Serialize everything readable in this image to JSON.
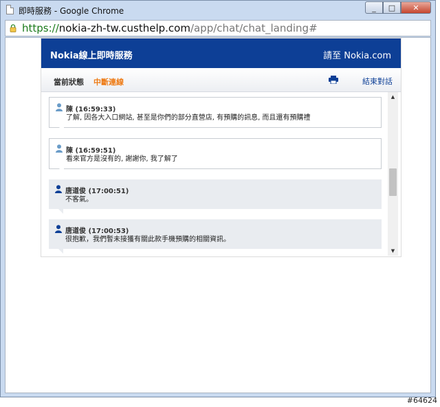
{
  "window": {
    "title": "即時服務 - Google Chrome",
    "buttons": {
      "minimize": "_",
      "maximize": "□",
      "close": "✕"
    }
  },
  "address": {
    "scheme": "https://",
    "host": "nokia-zh-tw.custhelp.com",
    "path": "/app/chat/chat_landing#"
  },
  "chat": {
    "header_title": "Nokia線上即時服務",
    "header_link": "請至 Nokia.com",
    "status_label": "當前狀態",
    "status_value": "中斷連線",
    "end_chat": "結束對話",
    "messages": [
      {
        "type": "user",
        "sender": "陳",
        "time": "(16:59:33)",
        "text": "了解, 因各大入口網站, 甚至是你們的部分直營店, 有預購的訊息, 而且還有預購禮"
      },
      {
        "type": "user",
        "sender": "陳",
        "time": "(16:59:51)",
        "text": "看來官方是沒有的, 謝謝你, 我了解了"
      },
      {
        "type": "agent",
        "sender": "唐道俊",
        "time": "(17:00:51)",
        "text": "不客氣。"
      },
      {
        "type": "agent",
        "sender": "唐道俊",
        "time": "(17:00:53)",
        "text": "很抱歉，我們暫未接獲有關此款手機預購的相關資訊。"
      }
    ]
  },
  "scroll": {
    "up": "▲",
    "down": "▼"
  },
  "watermark": "#64624",
  "colors": {
    "header": "#0d3f96",
    "status_value": "#ee7b15",
    "url_scheme": "#1a7a1a"
  }
}
